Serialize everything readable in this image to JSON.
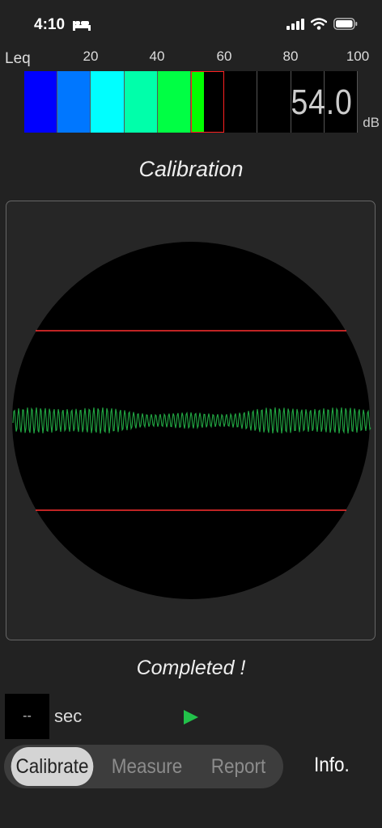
{
  "status": {
    "time": "4:10"
  },
  "meter": {
    "label": "Leq",
    "ticks": [
      "20",
      "40",
      "60",
      "80",
      "100"
    ],
    "value": "54.0",
    "unit": "dB",
    "level_db": 54,
    "colors": [
      "#0000ff",
      "#0077ff",
      "#00ffff",
      "#00ffaa",
      "#00ff44",
      "#00ff00"
    ],
    "marker_color": "#ff2020"
  },
  "title": "Calibration",
  "status_message": "Completed !",
  "timer": {
    "value": "--",
    "unit": "sec"
  },
  "tabs": [
    {
      "label": "Calibrate",
      "active": true
    },
    {
      "label": "Measure",
      "active": false
    },
    {
      "label": "Report",
      "active": false
    }
  ],
  "info_label": "Info.",
  "scope": {
    "waveform_color": "#22aa44",
    "threshold_color": "#ff3030"
  }
}
